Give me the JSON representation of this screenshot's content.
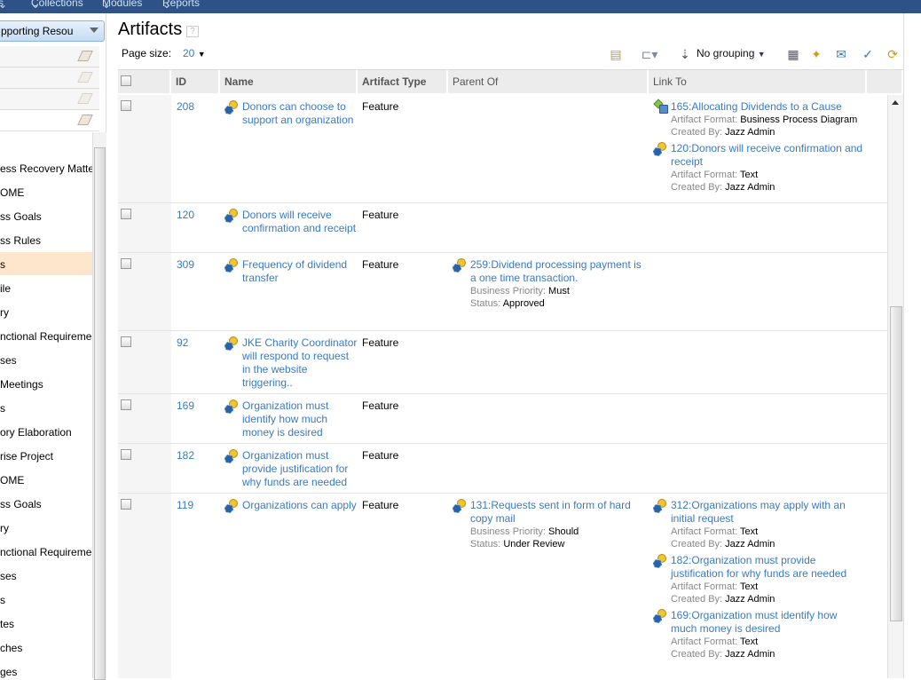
{
  "nav": [
    "s",
    "Collections",
    "Modules",
    "Reports"
  ],
  "sidebar": {
    "selector": "pporting Resou",
    "filters": 4,
    "items": [
      "ess Recovery Matte",
      "OME",
      "ss Goals",
      "ss Rules",
      "s",
      "ile",
      "ry",
      "nctional Requireme",
      "ses",
      " Meetings",
      "s",
      "ory Elaboration",
      "rise Project",
      "OME",
      "ss Goals",
      "ry",
      "nctional Requireme",
      "ses",
      "s",
      "tes",
      "ches",
      "ges"
    ],
    "selected_index": 4
  },
  "main": {
    "title": "Artifacts",
    "help": "?",
    "page_size_label": "Page size:",
    "page_size": "20",
    "grouping": "No grouping",
    "columns": [
      "ID",
      "Name",
      "Artifact Type",
      "Parent Of",
      "Link To"
    ],
    "rows": [
      {
        "id": "208",
        "name": "Donors can choose to support an organization",
        "type": "Feature",
        "parent": [],
        "links": [
          {
            "icon": "business-process-diagram-icon",
            "text": "165:Allocating Dividends to a Cause",
            "meta": [
              [
                "Artifact Format:",
                "Business Process Diagram"
              ],
              [
                "Created By:",
                "Jazz Admin"
              ]
            ]
          },
          {
            "icon": "feature-icon",
            "text": "120:Donors will receive confirmation and receipt",
            "meta": [
              [
                "Artifact Format:",
                "Text"
              ],
              [
                "Created By:",
                "Jazz Admin"
              ]
            ]
          }
        ]
      },
      {
        "id": "120",
        "name": "Donors will receive confirmation and receipt",
        "type": "Feature",
        "parent": [],
        "links": []
      },
      {
        "id": "309",
        "name": "Frequency of dividend transfer",
        "type": "Feature",
        "parent": [
          {
            "icon": "feature-icon",
            "text": "259:Dividend processing payment is a one time transaction.",
            "meta": [
              [
                "Business Priority:",
                "Must"
              ],
              [
                "Status:",
                "Approved"
              ]
            ]
          }
        ],
        "links": []
      },
      {
        "id": "92",
        "name": "JKE Charity Coordinator will respond to request in the website triggering..",
        "type": "Feature",
        "parent": [],
        "links": []
      },
      {
        "id": "169",
        "name": "Organization must identify how much money is desired",
        "type": "Feature",
        "parent": [],
        "links": []
      },
      {
        "id": "182",
        "name": "Organization must provide justification for why funds are needed",
        "type": "Feature",
        "parent": [],
        "links": []
      },
      {
        "id": "119",
        "name": "Organizations can apply",
        "type": "Feature",
        "parent": [
          {
            "icon": "feature-icon",
            "text": "131:Requests sent in form of hard copy mail",
            "meta": [
              [
                "Business Priority:",
                "Should"
              ],
              [
                "Status:",
                "Under Review"
              ]
            ]
          }
        ],
        "links": [
          {
            "icon": "feature-icon",
            "text": "312:Organizations may apply with an initial request",
            "meta": [
              [
                "Artifact Format:",
                "Text"
              ],
              [
                "Created By:",
                "Jazz Admin"
              ]
            ]
          },
          {
            "icon": "feature-icon",
            "text": "182:Organization must provide justification for why funds are needed",
            "meta": [
              [
                "Artifact Format:",
                "Text"
              ],
              [
                "Created By:",
                "Jazz Admin"
              ]
            ]
          },
          {
            "icon": "feature-icon",
            "text": "169:Organization must identify how much money is desired",
            "meta": [
              [
                "Artifact Format:",
                "Text"
              ],
              [
                "Created By:",
                "Jazz Admin"
              ]
            ]
          }
        ]
      }
    ]
  },
  "colors": {
    "nav_bg": "#2e5287",
    "link": "#3a7ac0",
    "selected": "#fde6cc"
  }
}
